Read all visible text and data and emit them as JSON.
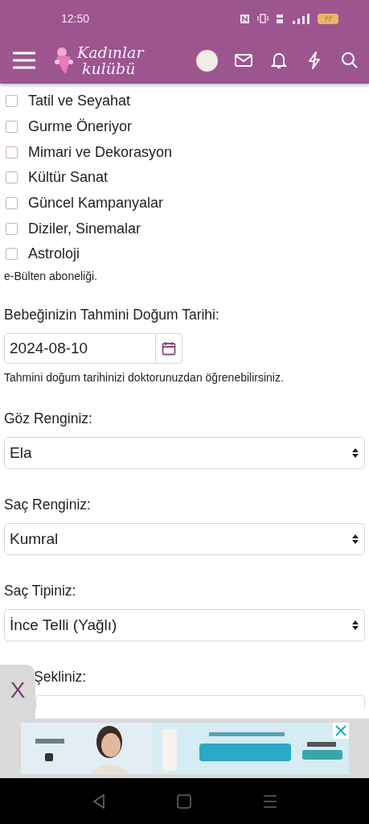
{
  "status_bar": {
    "time": "12:50",
    "battery": "77"
  },
  "header": {
    "logo_line_1": "Kadınlar",
    "logo_line_2": "kulübü"
  },
  "interests": [
    {
      "label": "Tatil ve Seyahat",
      "checked": false
    },
    {
      "label": "Gurme Öneriyor",
      "checked": false
    },
    {
      "label": "Mimari ve Dekorasyon",
      "checked": false
    },
    {
      "label": "Kültür Sanat",
      "checked": false
    },
    {
      "label": "Güncel Kampanyalar",
      "checked": false
    },
    {
      "label": "Diziler, Sinemalar",
      "checked": false
    },
    {
      "label": "Astroloji",
      "checked": false
    }
  ],
  "interests_help": "e-Bülten aboneliği.",
  "due_date": {
    "label": "Bebeğinizin Tahmini Doğum Tarihi:",
    "value": "2024-08-10",
    "help": "Tahmini doğum tarihinizi doktorunuzdan öğrenebilirsiniz."
  },
  "selects": [
    {
      "label": "Göz Renginiz:",
      "value": "Ela"
    },
    {
      "label": "Saç Renginiz:",
      "value": "Kumral"
    },
    {
      "label": "Saç Tipiniz:",
      "value": "İnce Telli (Yağlı)"
    },
    {
      "label": "Şekliniz:"
    }
  ],
  "side_close": "X"
}
